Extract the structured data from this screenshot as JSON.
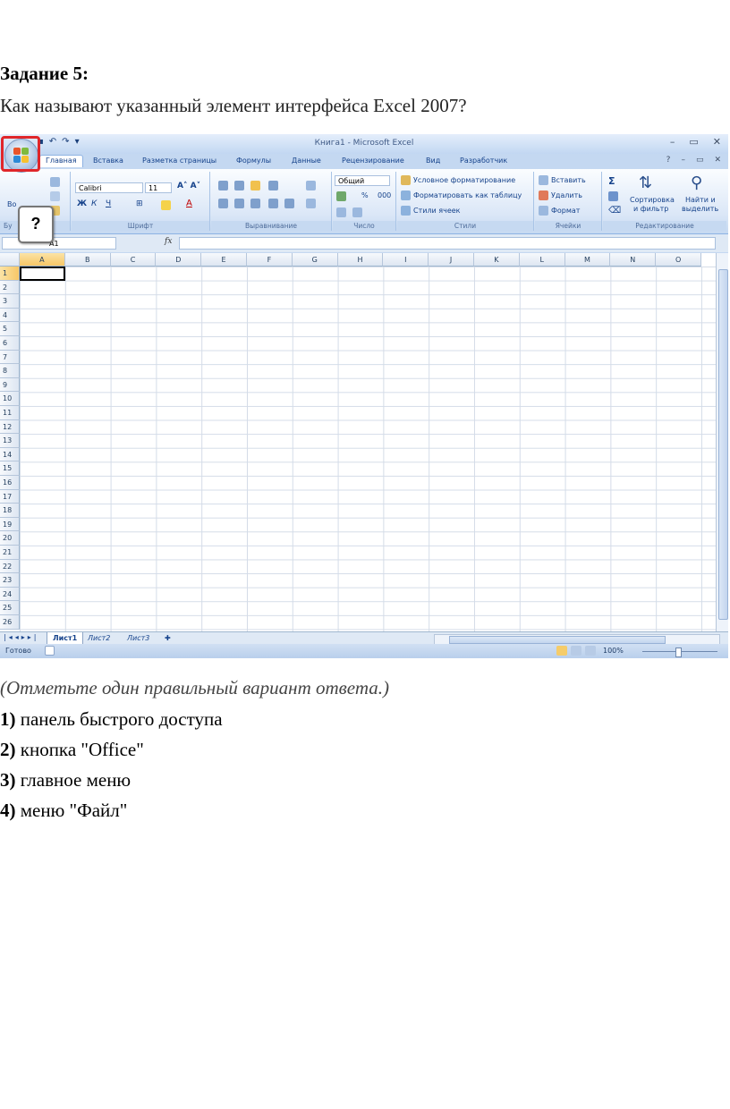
{
  "task": {
    "title": "Задание 5:",
    "question": "Как называют указанный элемент интерфейса Excel 2007?"
  },
  "excel": {
    "window_title": "Книга1 - Microsoft Excel",
    "callout": "?",
    "tabs": [
      "Главная",
      "Вставка",
      "Разметка страницы",
      "Формулы",
      "Данные",
      "Рецензирование",
      "Вид",
      "Разработчик"
    ],
    "ribbon": {
      "groups": [
        "Бу",
        "Шрифт",
        "Выравнивание",
        "Число",
        "Стили",
        "Ячейки",
        "Редактирование"
      ],
      "paste_label": "Во",
      "font_name": "Calibri",
      "font_size": "11",
      "number_format": "Общий",
      "percent": "%",
      "thousands": "000",
      "styles": [
        "Условное форматирование",
        "Форматировать как таблицу",
        "Стили ячеек"
      ],
      "cells": [
        "Вставить",
        "Удалить",
        "Формат"
      ],
      "sort_label_1": "Сортировка",
      "sort_label_2": "и фильтр",
      "find_label_1": "Найти и",
      "find_label_2": "выделить"
    },
    "name_box": "A1",
    "fx": "fx",
    "columns": [
      "A",
      "B",
      "C",
      "D",
      "E",
      "F",
      "G",
      "H",
      "I",
      "J",
      "K",
      "L",
      "M",
      "N",
      "O"
    ],
    "rows": [
      "1",
      "2",
      "3",
      "4",
      "5",
      "6",
      "7",
      "8",
      "9",
      "10",
      "11",
      "12",
      "13",
      "14",
      "15",
      "16",
      "17",
      "18",
      "19",
      "20",
      "21",
      "22",
      "23",
      "24",
      "25",
      "26"
    ],
    "sheets": [
      "Лист1",
      "Лист2",
      "Лист3"
    ],
    "status": "Готово",
    "zoom": "100%"
  },
  "answers": {
    "hint": "(Отметьте один правильный вариант ответа.)",
    "options": [
      {
        "num": "1)",
        "text": " панель быстрого доступа"
      },
      {
        "num": "2)",
        "text": " кнопка \"Office\""
      },
      {
        "num": "3)",
        "text": " главное меню"
      },
      {
        "num": "4)",
        "text": " меню \"Файл\""
      }
    ]
  }
}
